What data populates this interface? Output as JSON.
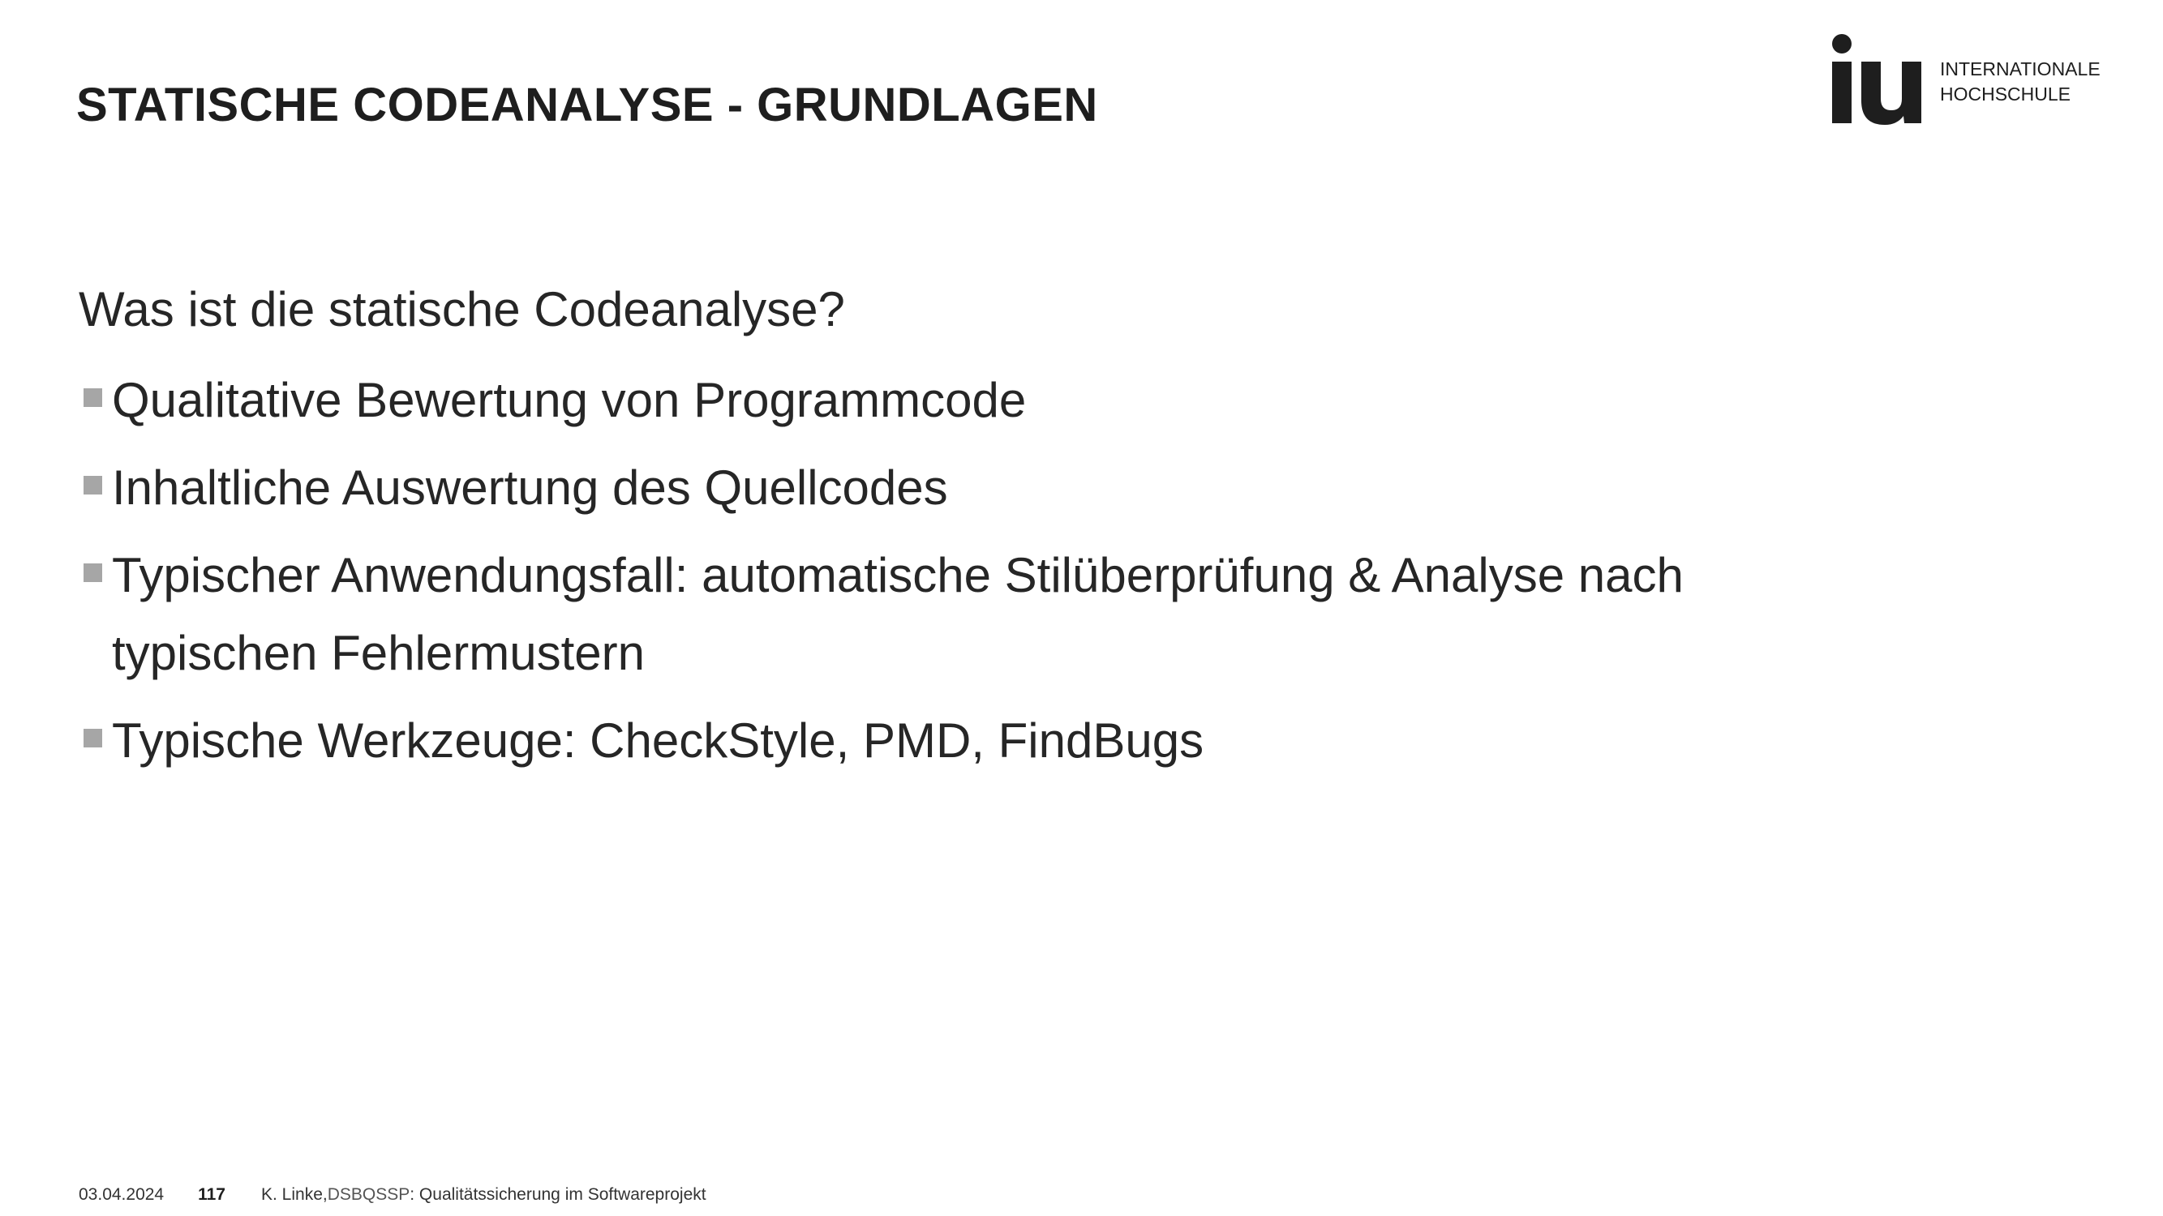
{
  "slide": {
    "title": "STATISCHE CODEANALYSE - GRUNDLAGEN",
    "question": "Was ist die statische Codeanalyse?",
    "bullets": [
      "Qualitative Bewertung von Programmcode",
      "Inhaltliche Auswertung des Quellcodes",
      "Typischer Anwendungsfall: automatische Stilüberprüfung & Analyse nach typischen Fehlermustern",
      "Typische Werkzeuge: CheckStyle, PMD, FindBugs"
    ]
  },
  "logo": {
    "mark": "iu",
    "line1": "INTERNATIONALE",
    "line2": "HOCHSCHULE"
  },
  "footer": {
    "date": "03.04.2024",
    "page": "117",
    "author": "K. Linke, ",
    "course_code": "DSBQSSP",
    "course_title": ": Qualitätssicherung im Softwareprojekt"
  },
  "colors": {
    "text": "#262626",
    "bullet": "#a6a6a6",
    "logo": "#1e1e1e"
  }
}
